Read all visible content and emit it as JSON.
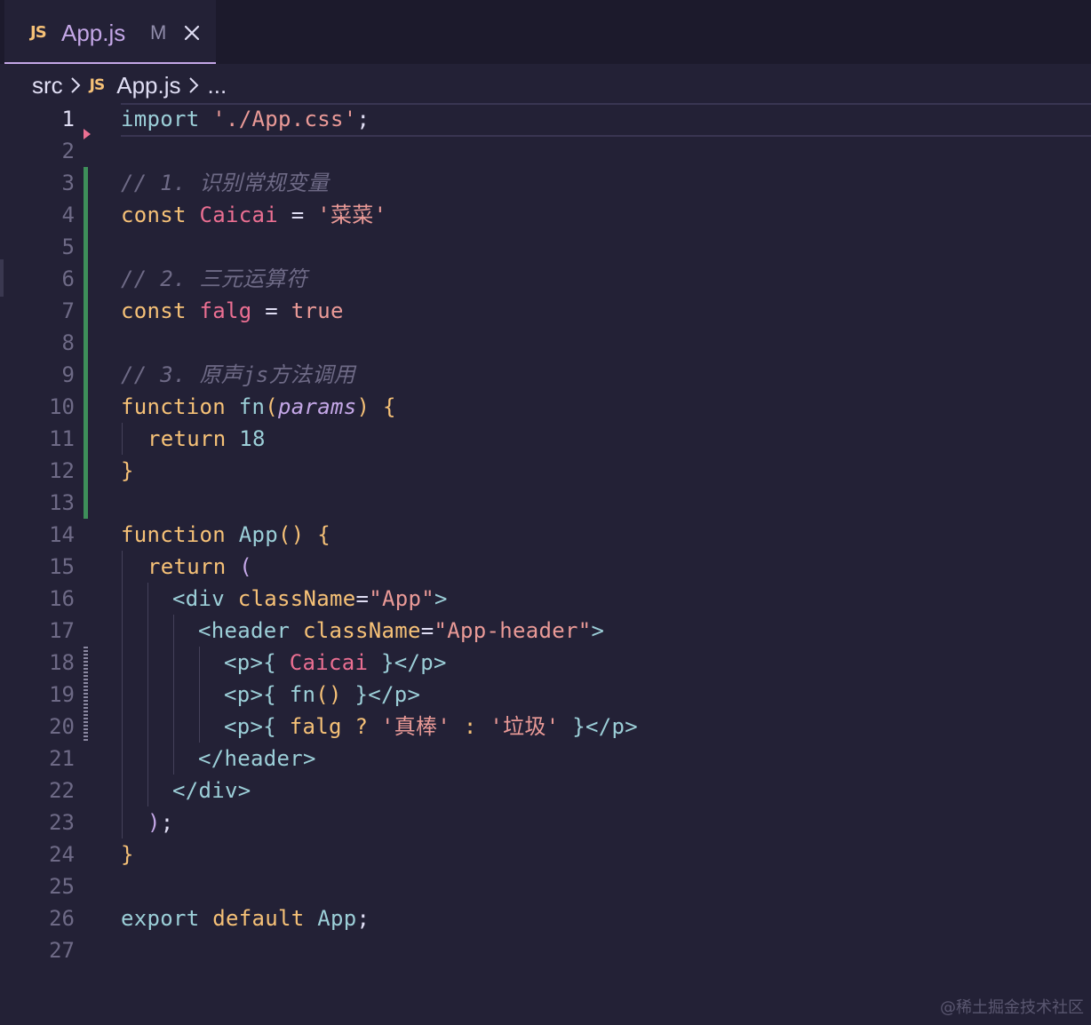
{
  "tab": {
    "language_badge": "JS",
    "title": "App.js",
    "modified_marker": "M",
    "close_icon": "close-icon"
  },
  "breadcrumb": {
    "folder": "src",
    "language_badge": "JS",
    "file": "App.js",
    "more": "..."
  },
  "colors": {
    "background": "#232136",
    "keyword": "#f6c177",
    "string": "#ea9a97",
    "comment": "#6e6a86",
    "function": "#9ccfd8",
    "git_added": "#3e8f5a"
  },
  "line_numbers": [
    "1",
    "2",
    "3",
    "4",
    "5",
    "6",
    "7",
    "8",
    "9",
    "10",
    "11",
    "12",
    "13",
    "14",
    "15",
    "16",
    "17",
    "18",
    "19",
    "20",
    "21",
    "22",
    "23",
    "24",
    "25",
    "26",
    "27"
  ],
  "code": {
    "l1": {
      "a": "import",
      "b": " ",
      "c": "'./App.css'",
      "d": ";"
    },
    "l3": {
      "a": "// 1. 识别常规变量"
    },
    "l4": {
      "a": "const",
      "b": " ",
      "c": "Caicai",
      "d": " = ",
      "e": "'菜菜'"
    },
    "l6": {
      "a": "// 2. 三元运算符"
    },
    "l7": {
      "a": "const",
      "b": " ",
      "c": "falg",
      "d": " = ",
      "e": "true"
    },
    "l9": {
      "a": "// 3. 原声js方法调用"
    },
    "l10": {
      "a": "function",
      "b": " ",
      "c": "fn",
      "d": "(",
      "e": "params",
      "f": ")",
      "g": " {"
    },
    "l11": {
      "a": "return",
      "b": " ",
      "c": "18"
    },
    "l12": {
      "a": "}"
    },
    "l14": {
      "a": "function",
      "b": " ",
      "c": "App",
      "d": "()",
      "e": " {"
    },
    "l15": {
      "a": "return",
      "b": " ",
      "c": "("
    },
    "l16": {
      "a": "<div",
      "b": " ",
      "c": "className",
      "d": "=",
      "e": "\"App\"",
      "f": ">"
    },
    "l17": {
      "a": "<header",
      "b": " ",
      "c": "className",
      "d": "=",
      "e": "\"App-header\"",
      "f": ">"
    },
    "l18": {
      "a": "<p>",
      "b": "{",
      "c": " Caicai ",
      "d": "}",
      "e": "</p>"
    },
    "l19": {
      "a": "<p>",
      "b": "{",
      "c": " fn",
      "d": "()",
      "e": " }",
      "f": "</p>"
    },
    "l20": {
      "a": "<p>",
      "b": "{",
      "c": " falg ",
      "d": "?",
      "e": " '真棒' ",
      "f": ":",
      "g": " '垃圾' ",
      "h": "}",
      "i": "</p>"
    },
    "l21": {
      "a": "</header>"
    },
    "l22": {
      "a": "</div>"
    },
    "l23": {
      "a": ")",
      "b": ";"
    },
    "l24": {
      "a": "}"
    },
    "l26": {
      "a": "export",
      "b": " ",
      "c": "default",
      "d": " ",
      "e": "App",
      "f": ";"
    }
  },
  "watermark": "@稀土掘金技术社区"
}
